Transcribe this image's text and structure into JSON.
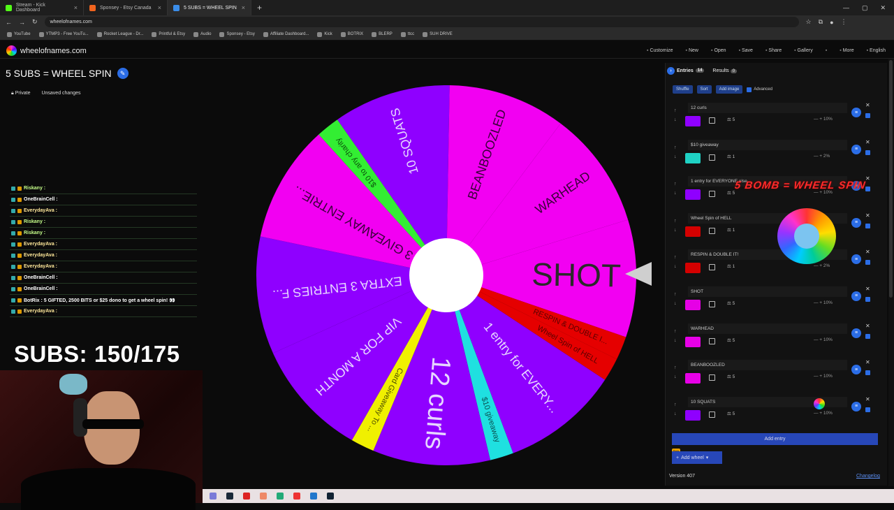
{
  "browser": {
    "tabs": [
      {
        "label": "Stream - Kick Dashboard",
        "color": "#53fc18"
      },
      {
        "label": "Sponsey - Etsy Canada",
        "color": "#f1641e"
      },
      {
        "label": "5 SUBS = WHEEL SPIN",
        "color": "#3b8eea"
      }
    ],
    "url": "wheelofnames.com",
    "bookmarks": [
      "YouTube",
      "YTMP3 - Free YouTu...",
      "Rocket League - Dr...",
      "Printful & Etsy",
      "Audio",
      "Sponsey - Etsy",
      "Affiliate Dashboard...",
      "Kick",
      "BOTRIX",
      "BLERP",
      "ttcc",
      "SUH DRIVE"
    ]
  },
  "app": {
    "site": "wheelofnames.com",
    "menu": [
      "Customize",
      "New",
      "Open",
      "Save",
      "Share",
      "Gallery",
      "Fullscreen",
      "More",
      "English"
    ],
    "wheel_title": "5 SUBS = WHEEL SPIN",
    "privacy": "Private",
    "status": "Unsaved changes"
  },
  "chat": [
    {
      "user": "Riskany :",
      "color": "#c6ff8a"
    },
    {
      "user": "OneBrainCell :",
      "color": "#ffffff"
    },
    {
      "user": "EverydayAva :",
      "color": "#ffe89a"
    },
    {
      "user": "Riskany :",
      "color": "#c6ff8a"
    },
    {
      "user": "Riskany :",
      "color": "#c6ff8a"
    },
    {
      "user": "EverydayAva :",
      "color": "#ffe89a"
    },
    {
      "user": "EverydayAva :",
      "color": "#ffe89a"
    },
    {
      "user": "EverydayAva :",
      "color": "#ffe89a"
    },
    {
      "user": "OneBrainCell :",
      "color": "#ffffff"
    },
    {
      "user": "OneBrainCell :",
      "color": "#ffffff"
    },
    {
      "user": "BotRix : 5 GIFTED, 2500 BITS or $25 dono to get a wheel spin! 👀",
      "color": "#ffffff"
    },
    {
      "user": "EverydayAva :",
      "color": "#ffe89a"
    }
  ],
  "overlay": {
    "subs": "SUBS: 150/175",
    "bomb": "5 BOMB = WHEEL SPIN"
  },
  "panel": {
    "tab_entries": "Entries",
    "entries_count": "14",
    "tab_results": "Results",
    "results_count": "0",
    "shuffle": "Shuffle",
    "sort": "Sort",
    "add_image": "Add image",
    "advanced": "Advanced",
    "add_entry": "Add entry",
    "add_wheel": "Add wheel",
    "beta": "Beta",
    "version": "Version 407",
    "changelog": "Changelog",
    "entries": [
      {
        "name": "12 curls",
        "weight": "5",
        "pct": "10%",
        "color": "#8f00ff"
      },
      {
        "name": "$10 giveaway",
        "weight": "1",
        "pct": "2%",
        "color": "#1fd1c4"
      },
      {
        "name": "1 entry for EVERYONE else",
        "weight": "5",
        "pct": "10%",
        "color": "#8f00ff"
      },
      {
        "name": "Wheel Spin of HELL",
        "weight": "1",
        "pct": "2%",
        "color": "#d40000"
      },
      {
        "name": "RESPIN & DOUBLE IT!",
        "weight": "1",
        "pct": "2%",
        "color": "#d40000"
      },
      {
        "name": "SHOT",
        "weight": "5",
        "pct": "10%",
        "color": "#e600e6"
      },
      {
        "name": "WARHEAD",
        "weight": "5",
        "pct": "10%",
        "color": "#e600e6"
      },
      {
        "name": "BEANBOOZLED",
        "weight": "5",
        "pct": "10%",
        "color": "#e600e6"
      },
      {
        "name": "10 SQUATS",
        "weight": "5",
        "pct": "10%",
        "color": "#8f00ff"
      }
    ]
  },
  "wheel": {
    "segments": [
      {
        "label": "SHOT",
        "weight": 5,
        "color": "#f200f2",
        "text": "#2a2a2a"
      },
      {
        "label": "RESPIN & DOUBLE I...",
        "weight": 1,
        "color": "#e50000",
        "text": "#5a0000"
      },
      {
        "label": "Wheel Spin of HELL",
        "weight": 1,
        "color": "#e50000",
        "text": "#5a0000"
      },
      {
        "label": "1 entry for EVERY...",
        "weight": 5,
        "color": "#8f00ff",
        "text": "#e6d6ff"
      },
      {
        "label": "$10 giveaway",
        "weight": 1,
        "color": "#1fe0e0",
        "text": "#0b4f4f"
      },
      {
        "label": "12 curls",
        "weight": 5,
        "color": "#8f00ff",
        "text": "#e6d6ff"
      },
      {
        "label": "Card Giveaway To ...",
        "weight": 1,
        "color": "#f0f000",
        "text": "#4f4f00"
      },
      {
        "label": "VIP FOR A MONTH",
        "weight": 5,
        "color": "#8f00ff",
        "text": "#e6d6ff"
      },
      {
        "label": "EXTRA 3 ENTRIES F...",
        "weight": 5,
        "color": "#8f00ff",
        "text": "#e6d6ff"
      },
      {
        "label": "3 GIVEAWAY ENTRIE...",
        "weight": 5,
        "color": "#f200f2",
        "text": "#3a003a"
      },
      {
        "label": "$10 to any charity",
        "weight": 1,
        "color": "#33ee33",
        "text": "#0c4f0c"
      },
      {
        "label": "10 SQUATS",
        "weight": 5,
        "color": "#8f00ff",
        "text": "#e6d6ff"
      },
      {
        "label": "BEANBOOZLED",
        "weight": 5,
        "color": "#f200f2",
        "text": "#3a003a"
      },
      {
        "label": "WARHEAD",
        "weight": 5,
        "color": "#f200f2",
        "text": "#3a003a"
      }
    ]
  }
}
